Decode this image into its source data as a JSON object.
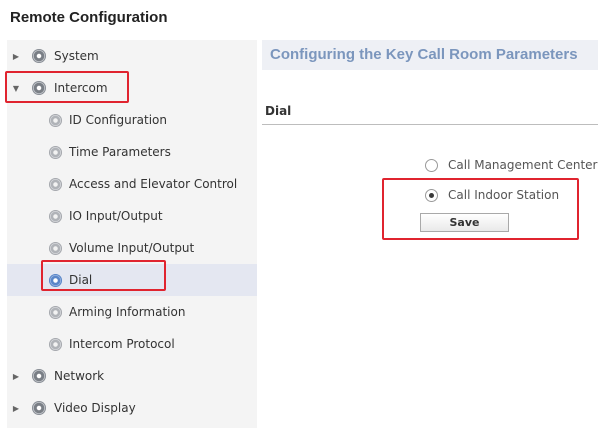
{
  "app": {
    "title": "Remote Configuration"
  },
  "sidebar": {
    "items": [
      {
        "label": "System",
        "expanded": false,
        "level": 0
      },
      {
        "label": "Intercom",
        "expanded": true,
        "level": 0
      },
      {
        "label": "ID Configuration",
        "level": 1
      },
      {
        "label": "Time Parameters",
        "level": 1
      },
      {
        "label": "Access and Elevator Control",
        "level": 1
      },
      {
        "label": "IO Input/Output",
        "level": 1
      },
      {
        "label": "Volume Input/Output",
        "level": 1
      },
      {
        "label": "Dial",
        "level": 1,
        "selected": true
      },
      {
        "label": "Arming Information",
        "level": 1
      },
      {
        "label": "Intercom Protocol",
        "level": 1
      },
      {
        "label": "Network",
        "expanded": false,
        "level": 0
      },
      {
        "label": "Video Display",
        "expanded": false,
        "level": 0
      }
    ]
  },
  "content": {
    "title": "Configuring the Key Call Room Parameters",
    "section_label": "Dial",
    "options": [
      {
        "label": "Call Management Center",
        "checked": false
      },
      {
        "label": "Call Indoor Station",
        "checked": true
      }
    ],
    "save_label": "Save"
  },
  "colors": {
    "highlight": "#e0242f",
    "title_accent": "#7b96bd",
    "selected_bg": "#e4e7f1",
    "sidebar_bg": "#f4f4f4"
  },
  "icons": {
    "collapsed": "chevron-right-icon",
    "expanded": "chevron-down-icon",
    "module": "gear-icon",
    "sub_module": "small-gear-icon"
  }
}
